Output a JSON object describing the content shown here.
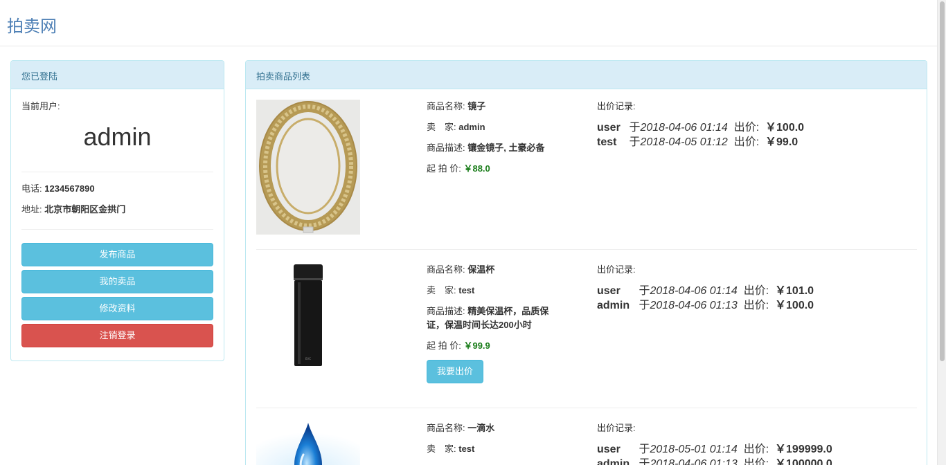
{
  "brand": "拍卖网",
  "sidebar": {
    "heading": "您已登陆",
    "current_user_label": "当前用户:",
    "username": "admin",
    "phone_label": "电话:",
    "phone": "1234567890",
    "address_label": "地址:",
    "address": "北京市朝阳区金拱门",
    "buttons": {
      "publish": "发布商品",
      "my_items": "我的卖品",
      "edit_profile": "修改资料",
      "logout": "注销登录"
    }
  },
  "main": {
    "heading": "拍卖商品列表",
    "labels": {
      "name": "商品名称:",
      "seller": "卖　家:",
      "desc": "商品描述:",
      "start_price": "起 拍 价:",
      "bids_title": "出价记录:",
      "bid_at": "于",
      "bid_offer": "出价:"
    },
    "items": [
      {
        "name": "镜子",
        "seller": "admin",
        "desc": "镶金镜子, 土豪必备",
        "start_price": "￥88.0",
        "bids": [
          {
            "user": "user",
            "time": "2018-04-06 01:14",
            "amount": "￥100.0"
          },
          {
            "user": "test",
            "time": "2018-04-05 01:12",
            "amount": "￥99.0"
          }
        ]
      },
      {
        "name": "保温杯",
        "seller": "test",
        "desc": "精美保温杯，品质保证，保温时间长达200小时",
        "start_price": "￥99.9",
        "bid_button": "我要出价",
        "bids": [
          {
            "user": "user",
            "time": "2018-04-06 01:14",
            "amount": "￥101.0"
          },
          {
            "user": "admin",
            "time": "2018-04-06 01:13",
            "amount": "￥100.0"
          }
        ]
      },
      {
        "name": "一滴水",
        "seller": "test",
        "bids": [
          {
            "user": "user",
            "time": "2018-05-01 01:14",
            "amount": "￥199999.0"
          },
          {
            "user": "admin",
            "time": "2018-04-06 01:13",
            "amount": "￥100000.0"
          }
        ]
      }
    ]
  }
}
